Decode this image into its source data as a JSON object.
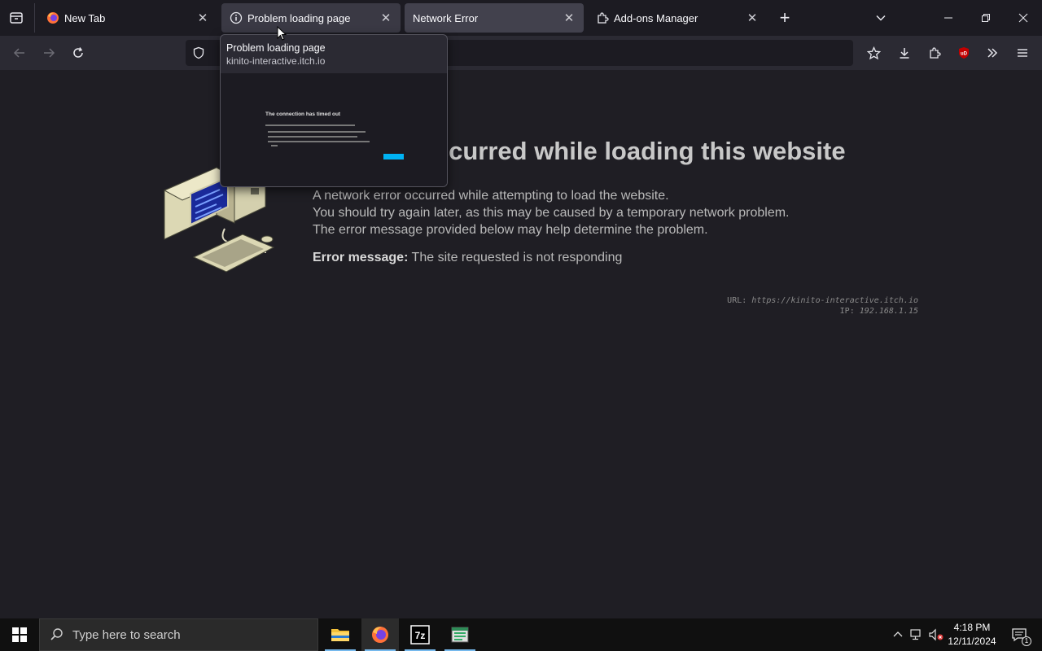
{
  "browser": {
    "tabs": [
      {
        "label": "New Tab",
        "icon": "firefox-icon"
      },
      {
        "label": "Problem loading page",
        "icon": "info-icon",
        "state": "hover"
      },
      {
        "label": "Network Error",
        "icon": "",
        "state": "active"
      },
      {
        "label": "Add-ons Manager",
        "icon": "puzzle-icon"
      }
    ],
    "tab_preview": {
      "title": "Problem loading page",
      "url": "kinito-interactive.itch.io",
      "thumb_heading": "The connection has timed out"
    }
  },
  "page": {
    "heading": "An error occurred while loading this website",
    "lines": [
      "A network error occurred while attempting to load the website.",
      "You should try again later, as this may be caused by a temporary network problem.",
      "The error message provided below may help determine the problem."
    ],
    "error_label": "Error message:",
    "error_value": "The site requested is not responding",
    "url_label": "URL:",
    "url_value": "https://kinito-interactive.itch.io",
    "ip_label": "IP:",
    "ip_value": "192.168.1.15"
  },
  "taskbar": {
    "search_placeholder": "Type here to search",
    "time": "4:18 PM",
    "date": "12/11/2024",
    "notification_count": "1"
  },
  "colors": {
    "accent": "#00b3f4",
    "text": "#b9b9b9",
    "background": "#1f1e24"
  }
}
